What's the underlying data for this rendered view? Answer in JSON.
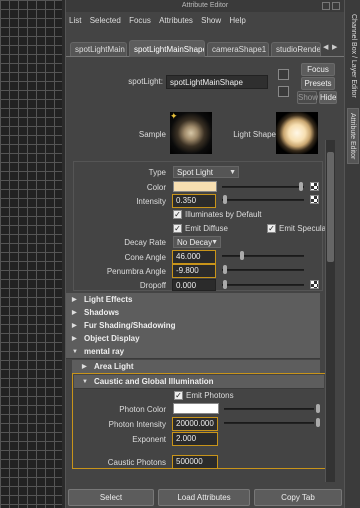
{
  "window": {
    "title": "Attribute Editor"
  },
  "menu": [
    "List",
    "Selected",
    "Focus",
    "Attributes",
    "Show",
    "Help"
  ],
  "tabs": [
    "spotLightMain",
    "spotLightMainShape",
    "cameraShape1",
    "studioRender"
  ],
  "node": {
    "label": "spotLight:",
    "value": "spotLightMainShape"
  },
  "buttons": {
    "focus": "Focus",
    "presets": "Presets",
    "show": "Show",
    "hide": "Hide"
  },
  "swatches": {
    "sample": "Sample",
    "light_shape": "Light Shape"
  },
  "attrs": {
    "type_label": "Type",
    "type_value": "Spot Light",
    "color_label": "Color",
    "intensity_label": "Intensity",
    "intensity_value": "0.350",
    "illum_default": "Illuminates by Default",
    "emit_diffuse": "Emit Diffuse",
    "emit_specular": "Emit Specular",
    "decay_label": "Decay Rate",
    "decay_value": "No Decay",
    "cone_label": "Cone Angle",
    "cone_value": "46.000",
    "penumbra_label": "Penumbra Angle",
    "penumbra_value": "-9.800",
    "dropoff_label": "Dropoff",
    "dropoff_value": "0.000"
  },
  "sections": [
    "Light Effects",
    "Shadows",
    "Fur Shading/Shadowing",
    "Object Display",
    "mental ray"
  ],
  "mentalray": {
    "area_light": "Area Light",
    "caustic": "Caustic and Global Illumination",
    "emit_photons": "Emit Photons",
    "photon_color_label": "Photon Color",
    "photon_intensity_label": "Photon Intensity",
    "photon_intensity_value": "20000.000",
    "exponent_label": "Exponent",
    "exponent_value": "2.000",
    "caustic_photons_label": "Caustic Photons",
    "caustic_photons_value": "500000"
  },
  "bottom": {
    "select": "Select",
    "load": "Load Attributes",
    "copy": "Copy Tab"
  },
  "side_tabs": {
    "channel_box": "Channel Box / Layer Editor",
    "attribute_editor": "Attribute Editor"
  },
  "colors": {
    "accent": "#c8941a",
    "light_color": "#f7dfb1"
  }
}
